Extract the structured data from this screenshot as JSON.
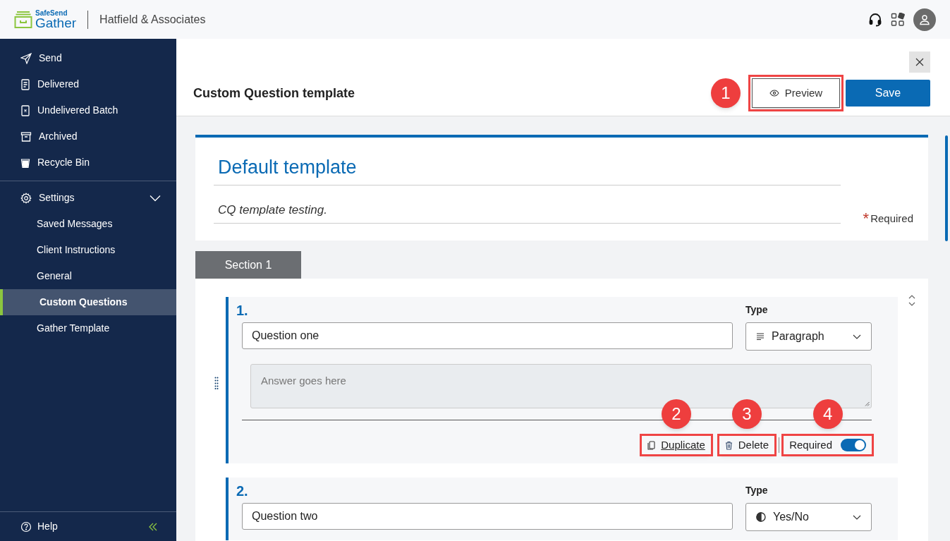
{
  "header": {
    "logo_top": "SafeSend",
    "logo_bottom": "Gather",
    "company": "Hatfield & Associates"
  },
  "sidebar": {
    "items": [
      {
        "label": "Send",
        "kind": "send"
      },
      {
        "label": "Delivered",
        "kind": "doc"
      },
      {
        "label": "Undelivered Batch",
        "kind": "xdoc"
      },
      {
        "label": "Archived",
        "kind": "archive"
      },
      {
        "label": "Recycle Bin",
        "kind": "bin"
      }
    ],
    "settings": {
      "label": "Settings",
      "expanded": true,
      "children": [
        {
          "label": "Saved Messages",
          "selected": false
        },
        {
          "label": "Client Instructions",
          "selected": false
        },
        {
          "label": "General",
          "selected": false
        },
        {
          "label": "Custom Questions",
          "selected": true
        },
        {
          "label": "Gather Template",
          "selected": false
        }
      ]
    },
    "help": "Help"
  },
  "page": {
    "title": "Custom Question template",
    "preview": {
      "label": "Preview",
      "callout": "1"
    },
    "save": "Save"
  },
  "template": {
    "title": "Default template",
    "description": "CQ template testing.",
    "required_mark": "*",
    "required_note": "Required"
  },
  "section_tab": "Section 1",
  "questions": [
    {
      "number": "1.",
      "text": "Question one",
      "type_label": "Type",
      "type": "Paragraph",
      "kind": "paragraph",
      "answer_placeholder": "Answer goes here",
      "actions": {
        "duplicate": {
          "label": "Duplicate",
          "callout": "2"
        },
        "delete": {
          "label": "Delete",
          "callout": "3"
        },
        "required": {
          "label": "Required",
          "on": true,
          "callout": "4"
        }
      }
    },
    {
      "number": "2.",
      "text": "Question two",
      "type_label": "Type",
      "type": "Yes/No",
      "kind": "yesno"
    }
  ]
}
